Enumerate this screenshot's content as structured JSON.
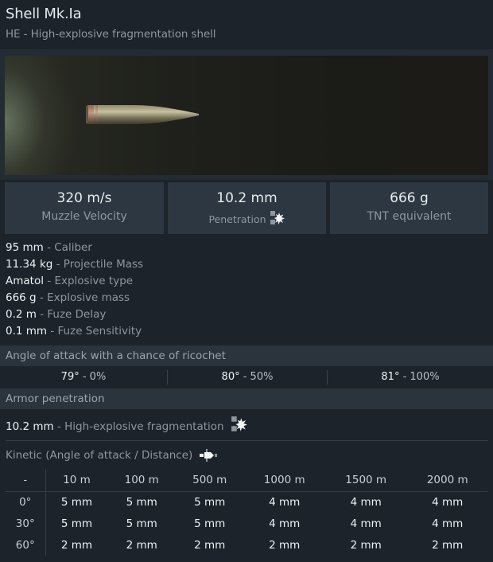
{
  "header": {
    "title": "Shell Mk.Ia",
    "subtitle": "HE - High-explosive fragmentation shell"
  },
  "preview": {
    "image_name": "shell-model-image"
  },
  "stats": [
    {
      "value": "320 m/s",
      "label": "Muzzle Velocity"
    },
    {
      "value": "10.2 mm",
      "label": "Penetration",
      "icon": "explosion-icon"
    },
    {
      "value": "666 g",
      "label": "TNT equivalent"
    }
  ],
  "properties": [
    {
      "value": "95 mm",
      "label": "Caliber"
    },
    {
      "value": "11.34 kg",
      "label": "Projectile Mass"
    },
    {
      "value": "Amatol",
      "label": "Explosive type"
    },
    {
      "value": "666 g",
      "label": "Explosive mass"
    },
    {
      "value": "0.2 m",
      "label": "Fuze Delay"
    },
    {
      "value": "0.1 mm",
      "label": "Fuze Sensitivity"
    }
  ],
  "prop_separator": " - ",
  "ricochet": {
    "title": "Angle of attack with a chance of ricochet",
    "cells": [
      {
        "angle": "79°",
        "chance": " - 0%"
      },
      {
        "angle": "80°",
        "chance": " - 50%"
      },
      {
        "angle": "81°",
        "chance": " - 100%"
      }
    ]
  },
  "armor_penetration": {
    "title": "Armor penetration",
    "he_value": "10.2 mm",
    "he_label": " - High-explosive fragmentation",
    "he_icon": "explosion-icon"
  },
  "kinetic": {
    "title": "Kinetic (Angle of attack / Distance)",
    "icon": "shell-impact-icon",
    "columns": [
      "-",
      "10 m",
      "100 m",
      "500 m",
      "1000 m",
      "1500 m",
      "2000 m"
    ],
    "rows": [
      [
        "0°",
        "5 mm",
        "5 mm",
        "5 mm",
        "4 mm",
        "4 mm",
        "4 mm"
      ],
      [
        "30°",
        "5 mm",
        "5 mm",
        "5 mm",
        "4 mm",
        "4 mm",
        "4 mm"
      ],
      [
        "60°",
        "2 mm",
        "2 mm",
        "2 mm",
        "2 mm",
        "2 mm",
        "2 mm"
      ]
    ]
  }
}
